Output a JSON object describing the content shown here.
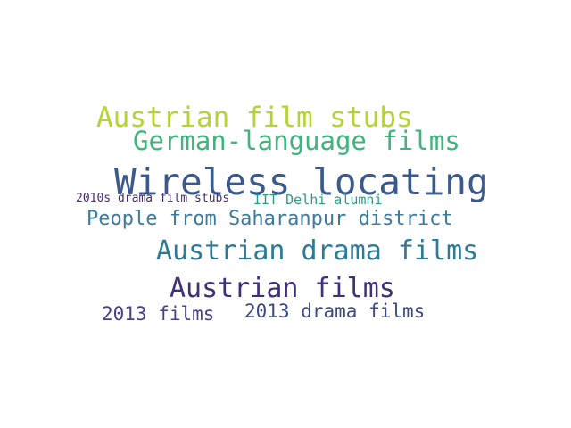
{
  "words": [
    {
      "text": "Wireless locating",
      "color": "#3b5a8c"
    },
    {
      "text": "Austrian film stubs",
      "color": "#b5d434"
    },
    {
      "text": "German-language films",
      "color": "#3fb47c"
    },
    {
      "text": "People from Saharanpur district",
      "color": "#3a7b9e"
    },
    {
      "text": "Austrian drama films",
      "color": "#2f7a94"
    },
    {
      "text": "Austrian films",
      "color": "#412f7a"
    },
    {
      "text": "2013 films",
      "color": "#4b3f8a"
    },
    {
      "text": "2013 drama films",
      "color": "#3d4a86"
    },
    {
      "text": "2010s drama film stubs",
      "color": "#472b75"
    },
    {
      "text": "IIT Delhi alumni",
      "color": "#2a9d8a"
    }
  ]
}
